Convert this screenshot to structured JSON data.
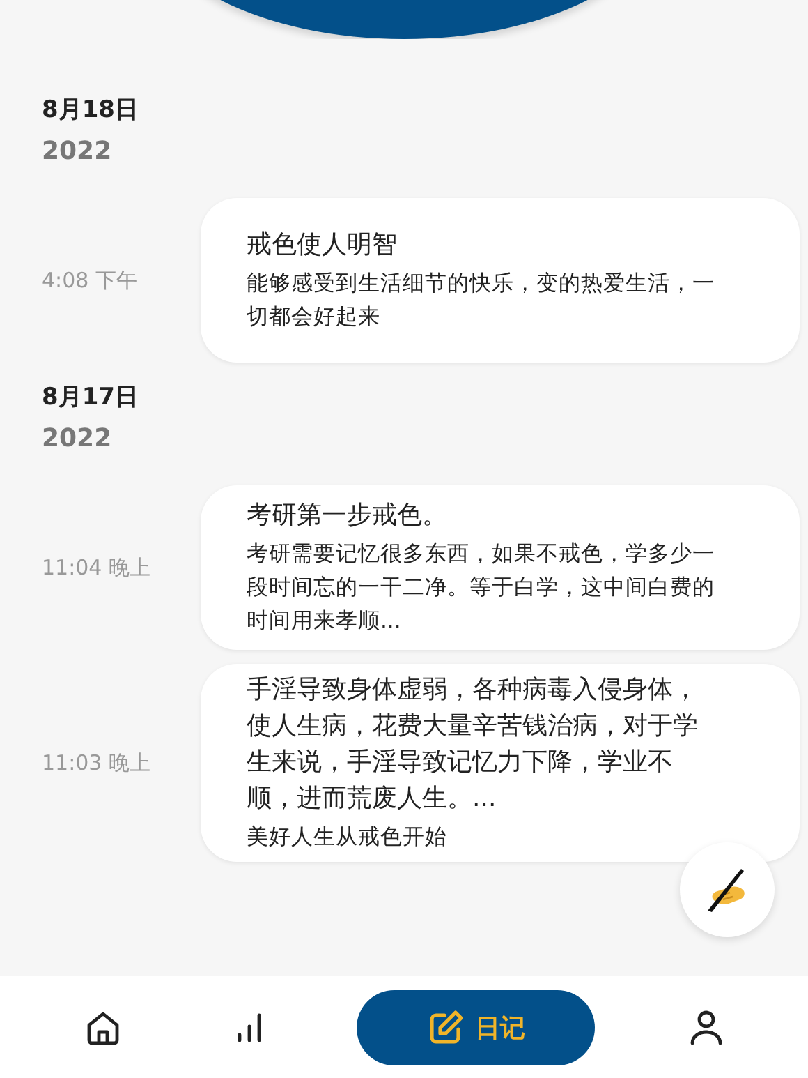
{
  "groups": [
    {
      "date": "8月18日",
      "year": "2022",
      "entries": [
        {
          "time": "4:08 下午",
          "title": "戒色使人明智",
          "body": "能够感受到生活细节的快乐，变的热爱生活，一切都会好起来"
        }
      ]
    },
    {
      "date": "8月17日",
      "year": "2022",
      "entries": [
        {
          "time": "11:04 晚上",
          "title": "考研第一步戒色。",
          "body": "考研需要记忆很多东西，如果不戒色，学多少一段时间忘的一干二净。等于白学，这中间白费的时间用来孝顺..."
        },
        {
          "time": "11:03 晚上",
          "title": "手淫导致身体虚弱，各种病毒入侵身体，使人生病，花费大量辛苦钱治病，对于学生来说，手淫导致记忆力下降，学业不顺，进而荒废人生。...",
          "body": "美好人生从戒色开始"
        }
      ]
    }
  ],
  "nav": [
    {
      "kind": "home",
      "selected": false
    },
    {
      "kind": "stats",
      "selected": false
    },
    {
      "kind": "diary",
      "label": "日记",
      "selected": true
    },
    {
      "kind": "profile",
      "selected": false
    }
  ]
}
